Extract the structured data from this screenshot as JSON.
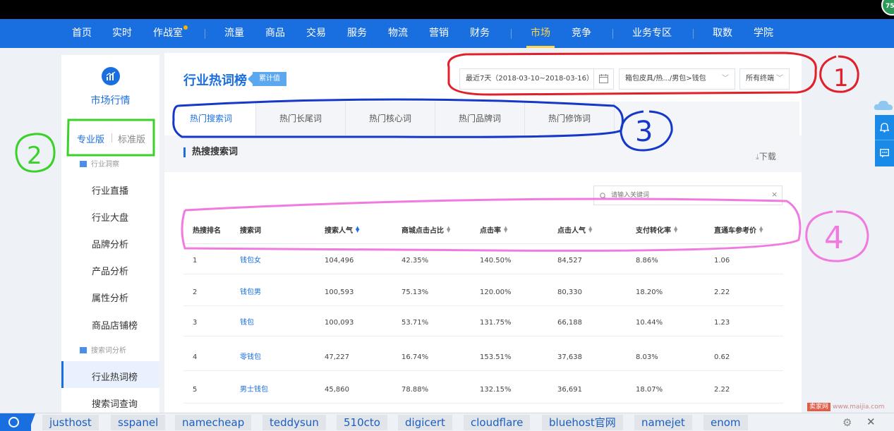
{
  "nav": {
    "items": [
      "首页",
      "实时",
      "作战室",
      "流量",
      "商品",
      "交易",
      "服务",
      "物流",
      "营销",
      "财务",
      "市场",
      "竞争",
      "业务专区",
      "取数",
      "学院"
    ],
    "active": "市场"
  },
  "badge": "75",
  "sidebar": {
    "title": "市场行情",
    "versions": {
      "pro": "专业版",
      "std": "标准版"
    },
    "section1": "行业洞察",
    "items1": [
      "行业直播",
      "行业大盘",
      "品牌分析",
      "产品分析",
      "属性分析",
      "商品店铺榜"
    ],
    "section2": "搜索词分析",
    "items2": [
      "行业热词榜",
      "搜索词查询"
    ]
  },
  "main": {
    "title": "行业热词榜",
    "tag": "累计值",
    "date_range": "最近7天（2018-03-10~2018-03-16）",
    "category": "箱包皮具/热.../男包>钱包",
    "terminal": "所有终端",
    "tabs": [
      "热门搜索词",
      "热门长尾词",
      "热门核心词",
      "热门品牌词",
      "热门修饰词"
    ],
    "section_title": "热搜搜索词",
    "download": "下载",
    "search_placeholder": "请输入关键词",
    "table": {
      "headers": [
        "热搜排名",
        "搜索词",
        "搜索人气",
        "商城点击占比",
        "点击率",
        "点击人气",
        "支付转化率",
        "直通车参考价"
      ],
      "rows": [
        [
          "1",
          "钱包女",
          "104,496",
          "42.35%",
          "140.50%",
          "84,527",
          "8.86%",
          "1.06"
        ],
        [
          "2",
          "钱包男",
          "100,593",
          "75.13%",
          "120.00%",
          "80,330",
          "18.20%",
          "2.22"
        ],
        [
          "3",
          "钱包",
          "100,093",
          "53.71%",
          "131.75%",
          "66,188",
          "10.44%",
          "1.23"
        ],
        [
          "4",
          "零钱包",
          "47,227",
          "16.74%",
          "153.51%",
          "37,638",
          "8.03%",
          "0.62"
        ],
        [
          "5",
          "男士钱包",
          "45,860",
          "78.88%",
          "132.15%",
          "36,691",
          "18.07%",
          "2.22"
        ]
      ]
    }
  },
  "taskbar": {
    "tabs": [
      "justhost",
      "sspanel",
      "namecheap",
      "teddysun",
      "510cto",
      "digicert",
      "cloudflare",
      "bluehost官网",
      "namejet",
      "enom"
    ]
  },
  "watermark": {
    "badge": "卖家网",
    "url": "www.maijia.com"
  },
  "annotations": {
    "n1": "1",
    "n2": "2",
    "n3": "3",
    "n4": "4"
  },
  "colors": {
    "brand": "#1a6fe0",
    "red_marker": "#e0202a",
    "green_marker": "#3ad12a",
    "blue_marker": "#1538c8",
    "pink_marker": "#f07ae0"
  }
}
